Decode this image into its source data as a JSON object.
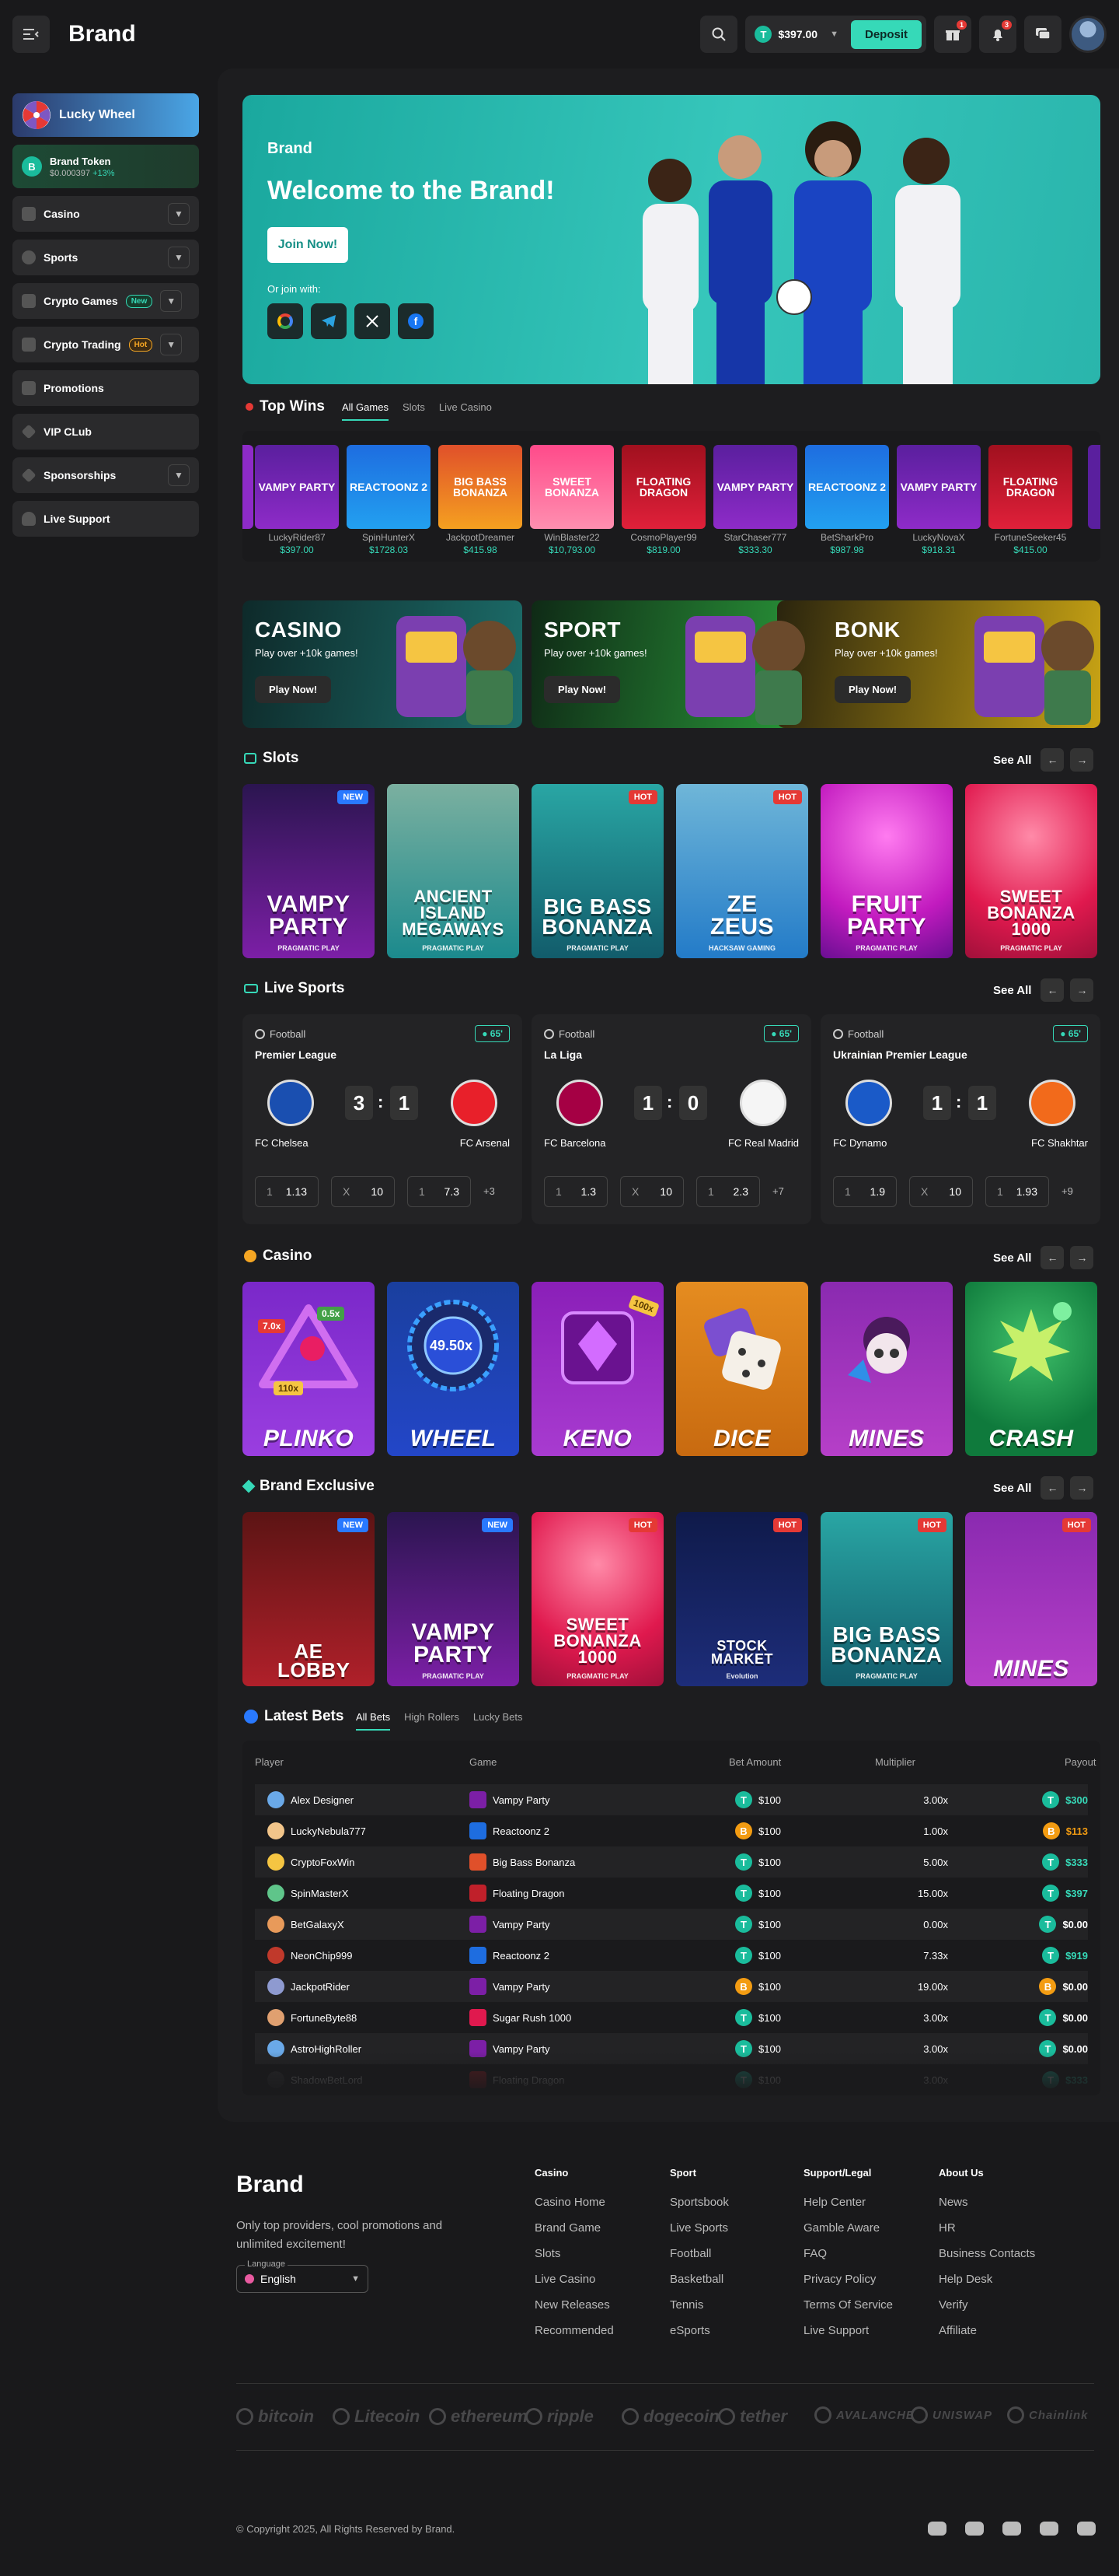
{
  "header": {
    "brand": "Brand",
    "balance": "$397.00",
    "balance_coin": "T",
    "deposit": "Deposit",
    "gift_badge": "1",
    "bell_badge": "3"
  },
  "sidebar": {
    "lucky_wheel": "Lucky Wheel",
    "token": {
      "name": "Brand Token",
      "value": "$0.000397",
      "change": "+13%"
    },
    "items": [
      {
        "label": "Casino"
      },
      {
        "label": "Sports"
      },
      {
        "label": "Crypto Games",
        "tag": "New"
      },
      {
        "label": "Crypto Trading",
        "tag": "Hot"
      },
      {
        "label": "Promotions"
      },
      {
        "label": "VIP CLub"
      },
      {
        "label": "Sponsorships"
      },
      {
        "label": "Live Support"
      }
    ]
  },
  "hero": {
    "brand": "Brand",
    "title": "Welcome to the Brand!",
    "cta": "Join Now!",
    "or_join": "Or join with:"
  },
  "top_wins": {
    "title": "Top Wins",
    "tabs": [
      "All Games",
      "Slots",
      "Live Casino"
    ],
    "items": [
      {
        "game": "VAMPY PARTY",
        "player": "LuckyRider87",
        "amount": "$397.00"
      },
      {
        "game": "REACTOONZ 2",
        "player": "SpinHunterX",
        "amount": "$1728.03"
      },
      {
        "game": "BIG BASS BONANZA",
        "player": "JackpotDreamer",
        "amount": "$415.98"
      },
      {
        "game": "SWEET BONANZA",
        "player": "WinBlaster22",
        "amount": "$10,793.00"
      },
      {
        "game": "FLOATING DRAGON",
        "player": "CosmoPlayer99",
        "amount": "$819.00"
      },
      {
        "game": "VAMPY PARTY",
        "player": "StarChaser777",
        "amount": "$333.30"
      },
      {
        "game": "REACTOONZ 2",
        "player": "BetSharkPro",
        "amount": "$987.98"
      },
      {
        "game": "VAMPY PARTY",
        "player": "LuckyNovaX",
        "amount": "$918.31"
      },
      {
        "game": "FLOATING DRAGON",
        "player": "FortuneSeeker45",
        "amount": "$415.00"
      }
    ]
  },
  "promos": [
    {
      "title": "CASINO",
      "sub": "Play over +10k games!",
      "cta": "Play Now!"
    },
    {
      "title": "SPORT",
      "sub": "Play over +10k games!",
      "cta": "Play Now!"
    },
    {
      "title": "BONK",
      "sub": "Play over +10k games!",
      "cta": "Play Now!"
    }
  ],
  "see_all": "See All",
  "slots": {
    "title": "Slots",
    "items": [
      {
        "name": "VAMPY PARTY",
        "provider": "PRAGMATIC PLAY",
        "tag": "NEW"
      },
      {
        "name": "ANCIENT ISLAND MEGAWAYS",
        "provider": "PRAGMATIC PLAY"
      },
      {
        "name": "BIG BASS BONANZA",
        "provider": "PRAGMATIC PLAY",
        "tag": "HOT"
      },
      {
        "name": "ZE ZEUS",
        "provider": "HACKSAW GAMING",
        "tag": "HOT"
      },
      {
        "name": "FRUIT PARTY",
        "provider": "PRAGMATIC PLAY"
      },
      {
        "name": "SWEET BONANZA 1000",
        "provider": "PRAGMATIC PLAY"
      }
    ]
  },
  "live_sports": {
    "title": "Live Sports",
    "matches": [
      {
        "sport": "Football",
        "minute": "65'",
        "league": "Premier League",
        "home": "FC Chelsea",
        "away": "FC Arsenal",
        "hs": "3",
        "as": "1",
        "odds": [
          "1.13",
          "10",
          "7.3"
        ],
        "more": "+3"
      },
      {
        "sport": "Football",
        "minute": "65'",
        "league": "La Liga",
        "home": "FC Barcelona",
        "away": "FC Real Madrid",
        "hs": "1",
        "as": "0",
        "odds": [
          "1.3",
          "10",
          "2.3"
        ],
        "more": "+7"
      },
      {
        "sport": "Football",
        "minute": "65'",
        "league": "Ukrainian Premier League",
        "home": "FC Dynamo",
        "away": "FC Shakhtar",
        "hs": "1",
        "as": "1",
        "odds": [
          "1.9",
          "10",
          "1.93"
        ],
        "more": "+9"
      }
    ]
  },
  "casino": {
    "title": "Casino",
    "items": [
      "PLINKO",
      "WHEEL",
      "KENO",
      "DICE",
      "MINES",
      "CRASH"
    ],
    "wheel_mult": "49.50x",
    "plinko_mults": [
      "7.0x",
      "0.5x",
      "110x"
    ],
    "keno_mult": "100x"
  },
  "exclusive": {
    "title": "Brand Exclusive",
    "items": [
      {
        "name": "AE LOBBY",
        "tag": "NEW"
      },
      {
        "name": "VAMPY PARTY",
        "provider": "PRAGMATIC PLAY",
        "tag": "NEW"
      },
      {
        "name": "SWEET BONANZA 1000",
        "provider": "PRAGMATIC PLAY",
        "tag": "HOT"
      },
      {
        "name": "STOCK MARKET",
        "provider": "Evolution",
        "tag": "HOT"
      },
      {
        "name": "BIG BASS BONANZA",
        "provider": "PRAGMATIC PLAY",
        "tag": "HOT"
      },
      {
        "name": "MINES",
        "tag": "HOT"
      }
    ]
  },
  "latest_bets": {
    "title": "Latest Bets",
    "tabs": [
      "All Bets",
      "High Rollers",
      "Lucky Bets"
    ],
    "columns": [
      "Player",
      "Game",
      "Bet Amount",
      "Multiplier",
      "Payout"
    ],
    "rows": [
      {
        "player": "Alex Designer",
        "game": "Vampy Party",
        "bet": "$100",
        "bc": "T",
        "mult": "3.00x",
        "payout": "$300",
        "pc": "T",
        "win": true
      },
      {
        "player": "LuckyNebula777",
        "game": "Reactoonz 2",
        "bet": "$100",
        "bc": "B",
        "mult": "1.00x",
        "payout": "$113",
        "pc": "B",
        "win": true
      },
      {
        "player": "CryptoFoxWin",
        "game": "Big Bass Bonanza",
        "bet": "$100",
        "bc": "T",
        "mult": "5.00x",
        "payout": "$333",
        "pc": "T",
        "win": true
      },
      {
        "player": "SpinMasterX",
        "game": "Floating Dragon",
        "bet": "$100",
        "bc": "T",
        "mult": "15.00x",
        "payout": "$397",
        "pc": "T",
        "win": true
      },
      {
        "player": "BetGalaxyX",
        "game": "Vampy Party",
        "bet": "$100",
        "bc": "T",
        "mult": "0.00x",
        "payout": "$0.00",
        "pc": "T",
        "win": false
      },
      {
        "player": "NeonChip999",
        "game": "Reactoonz 2",
        "bet": "$100",
        "bc": "T",
        "mult": "7.33x",
        "payout": "$919",
        "pc": "T",
        "win": true
      },
      {
        "player": "JackpotRider",
        "game": "Vampy Party",
        "bet": "$100",
        "bc": "B",
        "mult": "19.00x",
        "payout": "$0.00",
        "pc": "B",
        "win": false
      },
      {
        "player": "FortuneByte88",
        "game": "Sugar Rush 1000",
        "bet": "$100",
        "bc": "T",
        "mult": "3.00x",
        "payout": "$0.00",
        "pc": "T",
        "win": false
      },
      {
        "player": "AstroHighRoller",
        "game": "Vampy Party",
        "bet": "$100",
        "bc": "T",
        "mult": "3.00x",
        "payout": "$0.00",
        "pc": "T",
        "win": false
      },
      {
        "player": "ShadowBetLord",
        "game": "Floating Dragon",
        "bet": "$100",
        "bc": "T",
        "mult": "3.00x",
        "payout": "$333",
        "pc": "T",
        "win": true
      }
    ]
  },
  "footer": {
    "brand": "Brand",
    "tagline": "Only top providers, cool promotions and unlimited excitement!",
    "language_label": "Language",
    "language": "English",
    "columns": [
      {
        "title": "Casino",
        "links": [
          "Casino Home",
          "Brand Game",
          "Slots",
          "Live Casino",
          "New Releases",
          "Recommended"
        ]
      },
      {
        "title": "Sport",
        "links": [
          "Sportsbook",
          "Live Sports",
          "Football",
          "Basketball",
          "Tennis",
          "eSports"
        ]
      },
      {
        "title": "Support/Legal",
        "links": [
          "Help Center",
          "Gamble Aware",
          "FAQ",
          "Privacy Policy",
          "Terms Of Service",
          "Live Support"
        ]
      },
      {
        "title": "About Us",
        "links": [
          "News",
          "HR",
          "Business Contacts",
          "Help Desk",
          "Verify",
          "Affiliate"
        ]
      }
    ],
    "cryptos": [
      "bitcoin",
      "Litecoin",
      "ethereum",
      "ripple",
      "dogecoin",
      "tether",
      "AVALANCHE",
      "UNISWAP",
      "Chainlink"
    ],
    "copyright": "© Copyright 2025, All Rights Reserved by Brand."
  }
}
